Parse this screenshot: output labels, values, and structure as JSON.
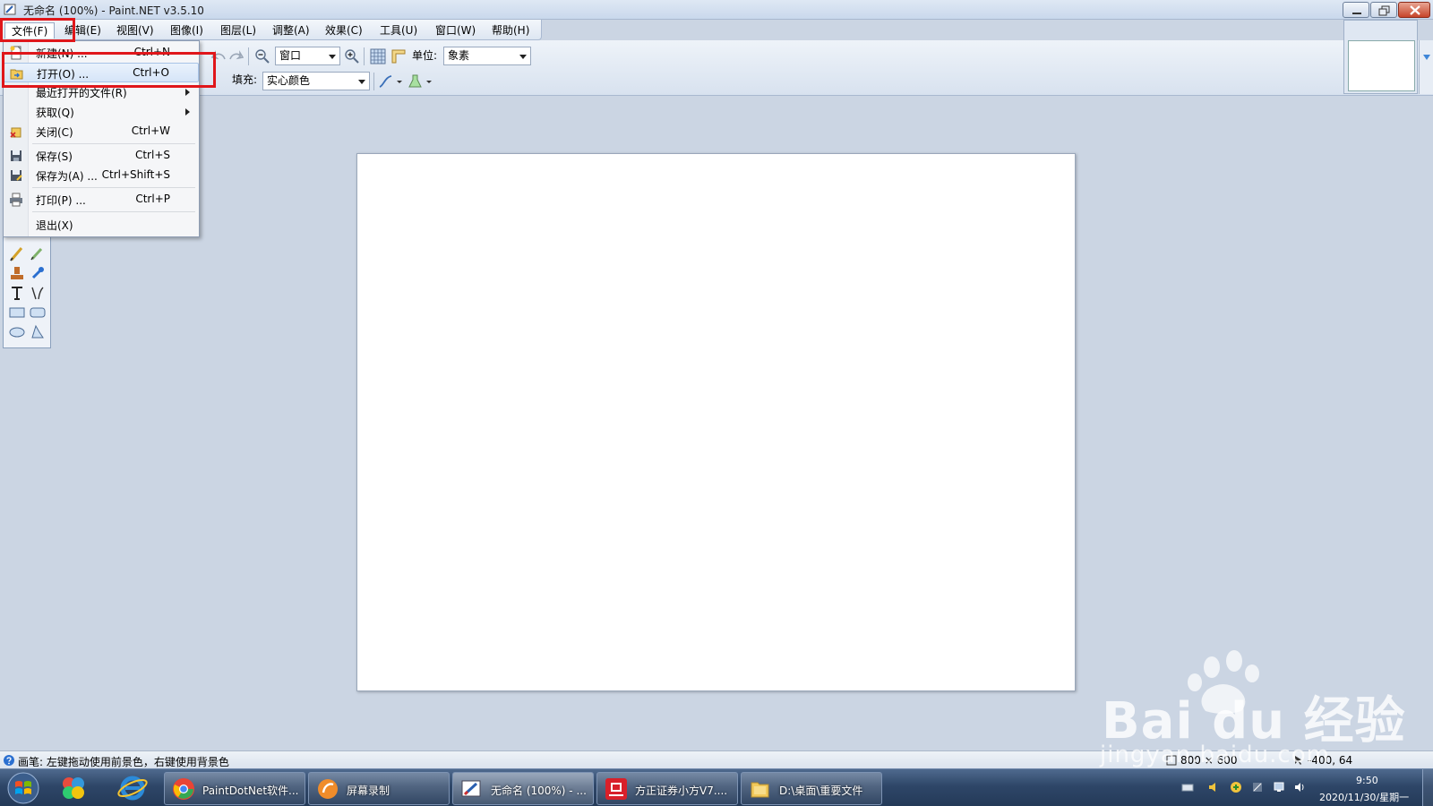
{
  "window": {
    "title": "无命名 (100%) - Paint.NET v3.5.10"
  },
  "menubar": {
    "items": [
      {
        "label": "文件(F)"
      },
      {
        "label": "编辑(E)"
      },
      {
        "label": "视图(V)"
      },
      {
        "label": "图像(I)"
      },
      {
        "label": "图层(L)"
      },
      {
        "label": "调整(A)"
      },
      {
        "label": "效果(C)"
      },
      {
        "label": "工具(U)"
      },
      {
        "label": "窗口(W)"
      },
      {
        "label": "帮助(H)"
      }
    ]
  },
  "toolbar": {
    "zoom_select": "窗口",
    "unit_label": "单位:",
    "unit_select": "象素",
    "fill_label": "填充:",
    "fill_select": "实心颜色"
  },
  "file_menu": {
    "items": [
      {
        "label": "新建(N) ...",
        "shortcut": "Ctrl+N",
        "icon": "new-file-icon"
      },
      {
        "label": "打开(O) ...",
        "shortcut": "Ctrl+O",
        "icon": "open-folder-icon",
        "highlighted": true
      },
      {
        "label": "最近打开的文件(R)",
        "shortcut": "",
        "icon": "",
        "submenu": true
      },
      {
        "label": "获取(Q)",
        "shortcut": "",
        "icon": "",
        "submenu": true
      },
      {
        "label": "关闭(C)",
        "shortcut": "Ctrl+W",
        "icon": "close-file-icon"
      },
      {
        "label": "保存(S)",
        "shortcut": "Ctrl+S",
        "icon": "save-icon"
      },
      {
        "label": "保存为(A) ...",
        "shortcut": "Ctrl+Shift+S",
        "icon": "save-as-icon"
      },
      {
        "label": "打印(P) ...",
        "shortcut": "Ctrl+P",
        "icon": "print-icon"
      },
      {
        "label": "退出(X)",
        "shortcut": "",
        "icon": ""
      }
    ]
  },
  "statusbar": {
    "hint": "画笔: 左键拖动使用前景色，右键使用背景色",
    "image_size": "800 × 600",
    "cursor_coords": "-400, 64"
  },
  "taskbar": {
    "tasks": [
      {
        "label": "PaintDotNet软件..."
      },
      {
        "label": "屏幕录制"
      },
      {
        "label": "无命名 (100%) - ..."
      },
      {
        "label": "方正证券小方V7...."
      },
      {
        "label": "D:\\桌面\\重要文件"
      }
    ],
    "clock_time": "9:50",
    "clock_date": "2020/11/30/星期一"
  },
  "watermark": {
    "line1": "Bai du 经验",
    "line2": "jingyan.baidu.com"
  },
  "colors": {
    "highlight_box": "#e0161a",
    "workspace": "#cbd5e3",
    "taskbar": "#2e4668"
  }
}
